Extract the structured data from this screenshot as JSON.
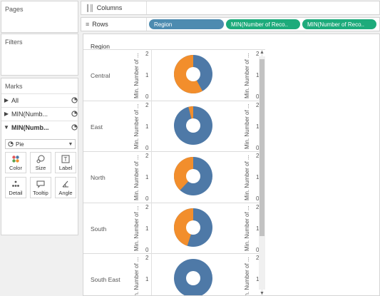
{
  "colors": {
    "pie_orange": "#f28e2c",
    "pie_blue": "#4e79a7",
    "dimension_pill": "#4d8bb0",
    "measure_pill": "#1dab7b"
  },
  "pages": {
    "title": "Pages"
  },
  "filters": {
    "title": "Filters"
  },
  "marks": {
    "title": "Marks",
    "cards": [
      {
        "label": "All",
        "icon": "pie-chart-icon"
      },
      {
        "label": "MIN(Numb...",
        "icon": "pie-chart-icon"
      },
      {
        "label": "MIN(Numb...",
        "icon": "pie-chart-icon"
      }
    ],
    "mark_type": "Pie",
    "buttons": [
      {
        "label": "Color",
        "icon": "color-icon"
      },
      {
        "label": "Size",
        "icon": "size-icon"
      },
      {
        "label": "Label",
        "icon": "label-icon"
      },
      {
        "label": "Detail",
        "icon": "detail-icon"
      },
      {
        "label": "Tooltip",
        "icon": "tooltip-icon"
      },
      {
        "label": "Angle",
        "icon": "angle-icon"
      }
    ]
  },
  "shelves": {
    "columns_label": "Columns",
    "rows_label": "Rows",
    "rows_pills": [
      "Region",
      "MIN(Number of Reco..",
      "MIN(Number of Reco.."
    ]
  },
  "view": {
    "region_header": "Region",
    "axis_title": "Min. Number of ...",
    "axis_ticks": [
      "2",
      "1",
      "0"
    ],
    "rows": [
      {
        "region": "Central",
        "orange_fraction": 0.58
      },
      {
        "region": "East",
        "orange_fraction": 0.04
      },
      {
        "region": "North",
        "orange_fraction": 0.38
      },
      {
        "region": "South",
        "orange_fraction": 0.45
      },
      {
        "region": "South East",
        "orange_fraction": 0.0
      }
    ]
  }
}
